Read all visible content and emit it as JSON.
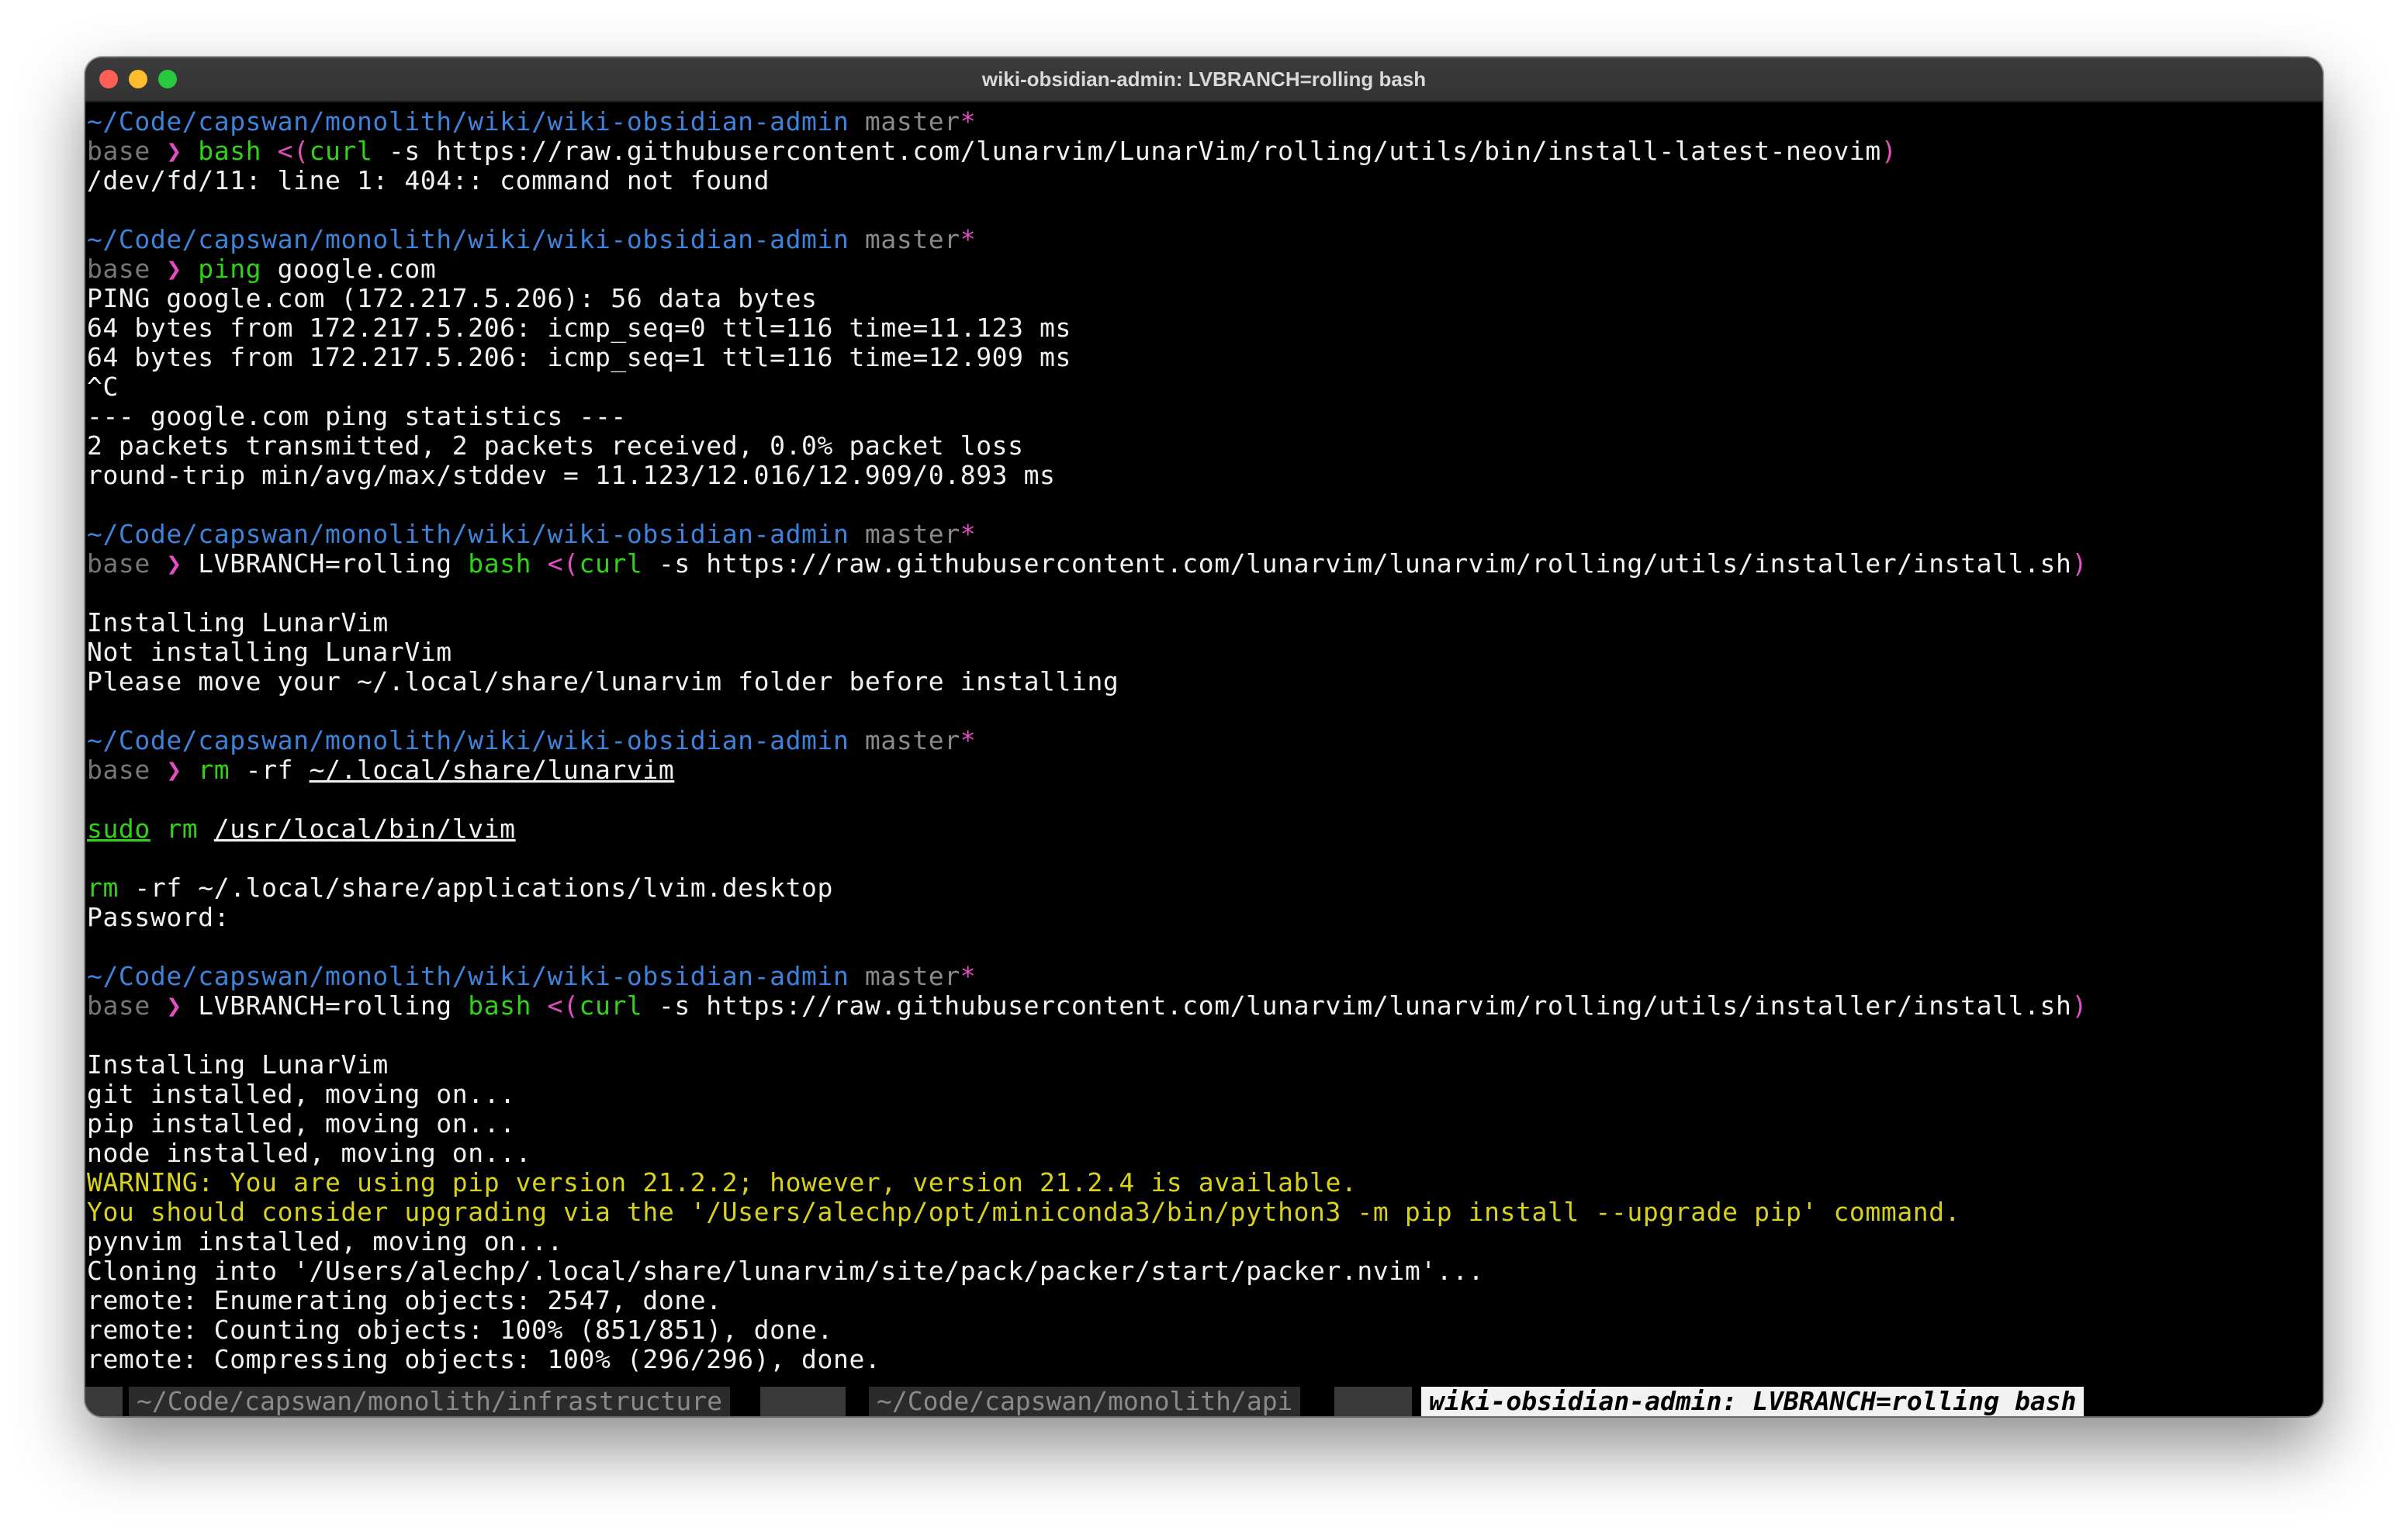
{
  "window": {
    "title": "wiki-obsidian-admin: LVBRANCH=rolling bash"
  },
  "prompt": {
    "path": "~/Code/capswan/monolith/wiki/wiki-obsidian-admin",
    "branch": "master",
    "dirty": "*",
    "env": "base",
    "symbol": "❯"
  },
  "blocks": {
    "b1": {
      "cmd": "bash",
      "open": " <(",
      "curl": "curl",
      "args": " -s https://raw.githubusercontent.com/lunarvim/LunarVim/rolling/utils/bin/install-latest-neovim",
      "close": ")",
      "out1": "/dev/fd/11: line 1: 404:: command not found"
    },
    "b2": {
      "cmd": "ping",
      "args": " google.com",
      "out": [
        "PING google.com (172.217.5.206): 56 data bytes",
        "64 bytes from 172.217.5.206: icmp_seq=0 ttl=116 time=11.123 ms",
        "64 bytes from 172.217.5.206: icmp_seq=1 ttl=116 time=12.909 ms",
        "^C",
        "--- google.com ping statistics ---",
        "2 packets transmitted, 2 packets received, 0.0% packet loss",
        "round-trip min/avg/max/stddev = 11.123/12.016/12.909/0.893 ms"
      ]
    },
    "b3": {
      "env_var": "LVBRANCH=rolling ",
      "cmd": "bash",
      "open": " <(",
      "curl": "curl",
      "args": " -s https://raw.githubusercontent.com/lunarvim/lunarvim/rolling/utils/installer/install.sh",
      "close": ")",
      "out": [
        "Installing LunarVim",
        "Not installing LunarVim",
        "Please move your ~/.local/share/lunarvim folder before installing"
      ]
    },
    "b4": {
      "cmd": "rm",
      "flag": " -rf ",
      "target": "~/.local/share/lunarvim",
      "sudo": "sudo",
      "rm2": "rm",
      "target2": "/usr/local/bin/lvim",
      "rm3": "rm",
      "args3": " -rf ~/.local/share/applications/lvim.desktop",
      "password": "Password:"
    },
    "b5": {
      "env_var": "LVBRANCH=rolling ",
      "cmd": "bash",
      "open": " <(",
      "curl": "curl",
      "args": " -s https://raw.githubusercontent.com/lunarvim/lunarvim/rolling/utils/installer/install.sh",
      "close": ")",
      "out_a": [
        "Installing LunarVim",
        "git installed, moving on...",
        "pip installed, moving on...",
        "node installed, moving on..."
      ],
      "warn": [
        "WARNING: You are using pip version 21.2.2; however, version 21.2.4 is available.",
        "You should consider upgrading via the '/Users/alechp/opt/miniconda3/bin/python3 -m pip install --upgrade pip' command."
      ],
      "out_b": [
        "pynvim installed, moving on...",
        "Cloning into '/Users/alechp/.local/share/lunarvim/site/pack/packer/start/packer.nvim'...",
        "remote: Enumerating objects: 2547, done.",
        "remote: Counting objects: 100% (851/851), done.",
        "remote: Compressing objects: 100% (296/296), done."
      ]
    }
  },
  "tabs": [
    {
      "label": "~/Code/capswan/monolith/infrastructure",
      "active": false
    },
    {
      "label": "~/Code/capswan/monolith/api",
      "active": false
    },
    {
      "label": "wiki-obsidian-admin: LVBRANCH=rolling bash",
      "active": true
    }
  ],
  "colors": {
    "path": "#3e82d9",
    "branch": "#8a8a8a",
    "accent": "#e34ec5",
    "command": "#32d219",
    "warning": "#d8d21c",
    "background": "#000000",
    "text": "#f2f2f2"
  }
}
